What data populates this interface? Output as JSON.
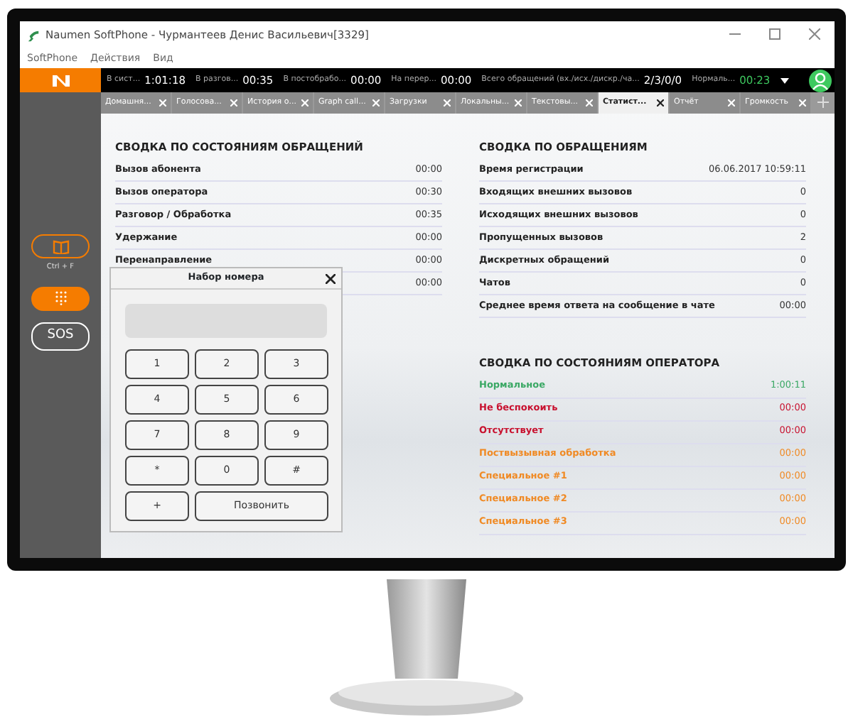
{
  "window": {
    "title": "Naumen SoftPhone - Чурмантеев Денис Васильевич[3329]"
  },
  "menu": [
    "SoftPhone",
    "Действия",
    "Вид"
  ],
  "status_bar": [
    {
      "label": "В сист...",
      "value": "1:01:18",
      "kind": "plain"
    },
    {
      "label": "В разгов...",
      "value": "00:35",
      "kind": "plain"
    },
    {
      "label": "В постобрабо...",
      "value": "00:00",
      "kind": "plain"
    },
    {
      "label": "На перер...",
      "value": "00:00",
      "kind": "plain"
    },
    {
      "label": "Всего обращений (вх./исх./дискр./ча...",
      "value": "2/3/0/0",
      "kind": "plain"
    },
    {
      "label": "Нормаль...",
      "value": "00:23",
      "kind": "status"
    }
  ],
  "tabs": [
    {
      "label": "Домашня...",
      "selected": false
    },
    {
      "label": "Голосова...",
      "selected": false
    },
    {
      "label": "История о...",
      "selected": false
    },
    {
      "label": "Graph call...",
      "selected": false
    },
    {
      "label": "Загрузки",
      "selected": false
    },
    {
      "label": "Локальны...",
      "selected": false
    },
    {
      "label": "Текстовы...",
      "selected": false
    },
    {
      "label": "Статист...",
      "selected": true
    },
    {
      "label": "Отчёт",
      "selected": false
    },
    {
      "label": "Громкость",
      "selected": false
    }
  ],
  "sidebar": {
    "shortcut": "Ctrl + F",
    "sos": "SOS"
  },
  "call_states": {
    "title": "СВОДКА ПО СОСТОЯНИЯМ ОБРАЩЕНИЙ",
    "rows": [
      {
        "label": "Вызов абонента",
        "value": "00:00"
      },
      {
        "label": "Вызов оператора",
        "value": "00:30"
      },
      {
        "label": "Разговор / Обработка",
        "value": "00:35"
      },
      {
        "label": "Удержание",
        "value": "00:00"
      },
      {
        "label": "Перенаправление",
        "value": "00:00"
      },
      {
        "value": "00:00"
      }
    ]
  },
  "calls_summary": {
    "title": "СВОДКА ПО ОБРАЩЕНИЯМ",
    "rows": [
      {
        "label": "Время регистрации",
        "value": "06.06.2017 10:59:11"
      },
      {
        "label": "Входящих внешних вызовов",
        "value": "0"
      },
      {
        "label": "Исходящих внешних вызовов",
        "value": "0"
      },
      {
        "label": "Пропущенных вызовов",
        "value": "2"
      },
      {
        "label": "Дискретных обращений",
        "value": "0"
      },
      {
        "label": "Чатов",
        "value": "0"
      },
      {
        "label": "Среднее время ответа на сообщение в чате",
        "value": "00:00"
      }
    ]
  },
  "operator_states": {
    "title": "СВОДКА ПО СОСТОЯНИЯМ ОПЕРАТОРА",
    "rows": [
      {
        "label": "Нормальное",
        "value": "1:00:11",
        "color": "#3aa864"
      },
      {
        "label": "Не беспокоить",
        "value": "00:00",
        "color": "#c8102e"
      },
      {
        "label": "Отсутствует",
        "value": "00:00",
        "color": "#c8102e"
      },
      {
        "label": "Поствызывная обработка",
        "value": "00:00",
        "color": "#f08a24"
      },
      {
        "label": "Специальное #1",
        "value": "00:00",
        "color": "#f08a24"
      },
      {
        "label": "Специальное #2",
        "value": "00:00",
        "color": "#f08a24"
      },
      {
        "label": "Специальное #3",
        "value": "00:00",
        "color": "#f08a24"
      }
    ]
  },
  "dialer": {
    "title": "Набор номера",
    "keys": [
      "1",
      "2",
      "3",
      "4",
      "5",
      "6",
      "7",
      "8",
      "9",
      "*",
      "0",
      "#",
      "+"
    ],
    "call_button": "Позвонить"
  }
}
